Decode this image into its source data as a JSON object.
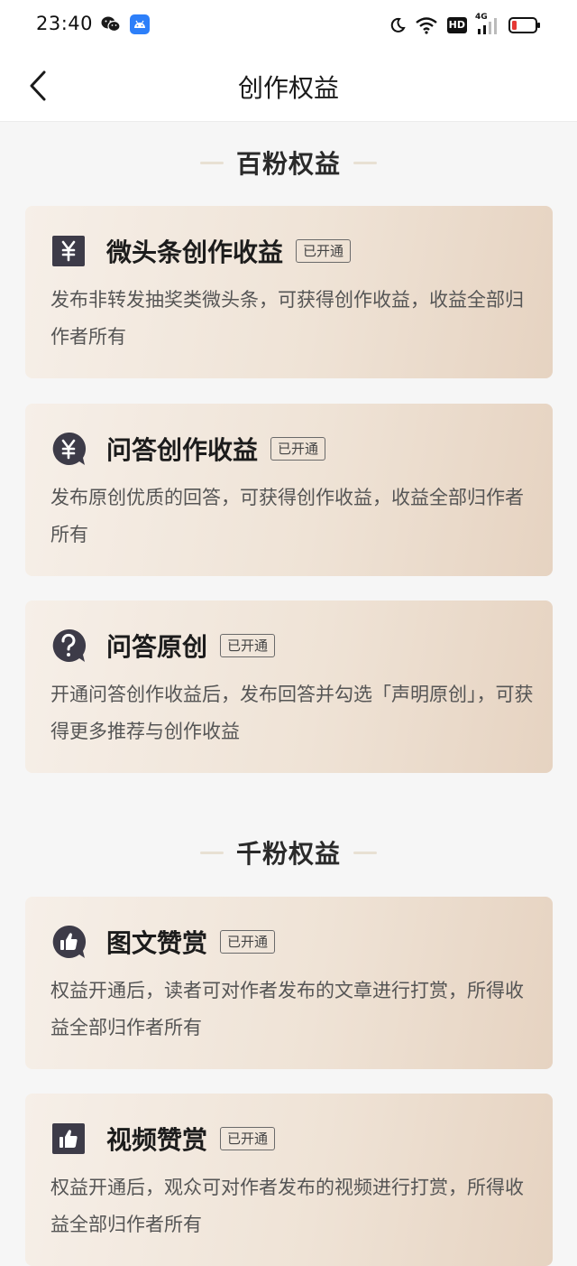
{
  "status_bar": {
    "time": "23:40",
    "left_icons": [
      "wechat-icon",
      "android-app-icon"
    ],
    "right_icons": [
      "moon-icon",
      "wifi-icon",
      "hd-icon",
      "signal-4g-icon",
      "battery-low-icon"
    ],
    "hd_label": "HD",
    "network_label": "4G"
  },
  "nav": {
    "title": "创作权益",
    "back_icon": "chevron-left-icon"
  },
  "sections": [
    {
      "title": "百粉权益",
      "cards": [
        {
          "icon": "yen-square-icon",
          "title": "微头条创作收益",
          "badge": "已开通",
          "description": "发布非转发抽奖类微头条，可获得创作收益，收益全部归作者所有"
        },
        {
          "icon": "yen-bubble-icon",
          "title": "问答创作收益",
          "badge": "已开通",
          "description": "发布原创优质的回答，可获得创作收益，收益全部归作者所有"
        },
        {
          "icon": "question-bubble-icon",
          "title": "问答原创",
          "badge": "已开通",
          "description": "开通问答创作收益后，发布回答并勾选「声明原创」，可获得更多推荐与创作收益"
        }
      ]
    },
    {
      "title": "千粉权益",
      "cards": [
        {
          "icon": "thumbs-up-bubble-icon",
          "title": "图文赞赏",
          "badge": "已开通",
          "description": "权益开通后，读者可对作者发布的文章进行打赏，所得收益全部归作者所有"
        },
        {
          "icon": "thumbs-up-square-icon",
          "title": "视频赞赏",
          "badge": "已开通",
          "description": "权益开通后，观众可对作者发布的视频进行打赏，所得收益全部归作者所有"
        }
      ]
    }
  ],
  "colors": {
    "background": "#f6f6f6",
    "card_gradient_start": "#f6efe8",
    "card_gradient_end": "#e6d3c1",
    "icon_dark": "#3d3b48",
    "battery_low": "#e53935"
  }
}
